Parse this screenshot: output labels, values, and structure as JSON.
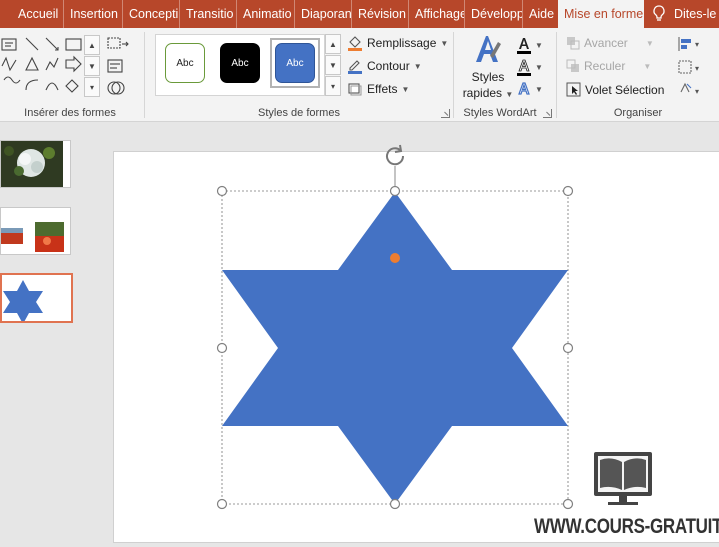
{
  "tabs": [
    {
      "label": "Accueil",
      "active": false
    },
    {
      "label": "Insertion",
      "active": false
    },
    {
      "label": "Concepti",
      "active": false
    },
    {
      "label": "Transitio",
      "active": false
    },
    {
      "label": "Animatio",
      "active": false
    },
    {
      "label": "Diaporan",
      "active": false
    },
    {
      "label": "Révision",
      "active": false
    },
    {
      "label": "Affichage",
      "active": false
    },
    {
      "label": "Développ",
      "active": false
    },
    {
      "label": "Aide",
      "active": false
    },
    {
      "label": "Mise en forme",
      "active": true
    }
  ],
  "tell_me": {
    "label": "Dites-le",
    "icon": "lightbulb-icon"
  },
  "groups": {
    "insert_shapes": {
      "label": "Insérer des formes"
    },
    "shape_styles": {
      "label": "Styles de formes",
      "gallery": [
        "Abc",
        "Abc",
        "Abc"
      ],
      "fill": "Remplissage",
      "outline": "Contour",
      "effects": "Effets"
    },
    "wordart": {
      "label": "Styles WordArt",
      "quick_styles_line1": "Styles",
      "quick_styles_line2": "rapides"
    },
    "arrange": {
      "label": "Organiser",
      "bring_forward": "Avancer",
      "send_backward": "Reculer",
      "selection_pane": "Volet Sélection"
    }
  },
  "colors": {
    "tab_bar": "#b7472a",
    "shape_fill": "#4472c4",
    "selection_handle": "#808080",
    "adjust_handle": "#ed7d31"
  },
  "watermark": {
    "text": "WWW.COURS-GRATUIT.COM"
  }
}
